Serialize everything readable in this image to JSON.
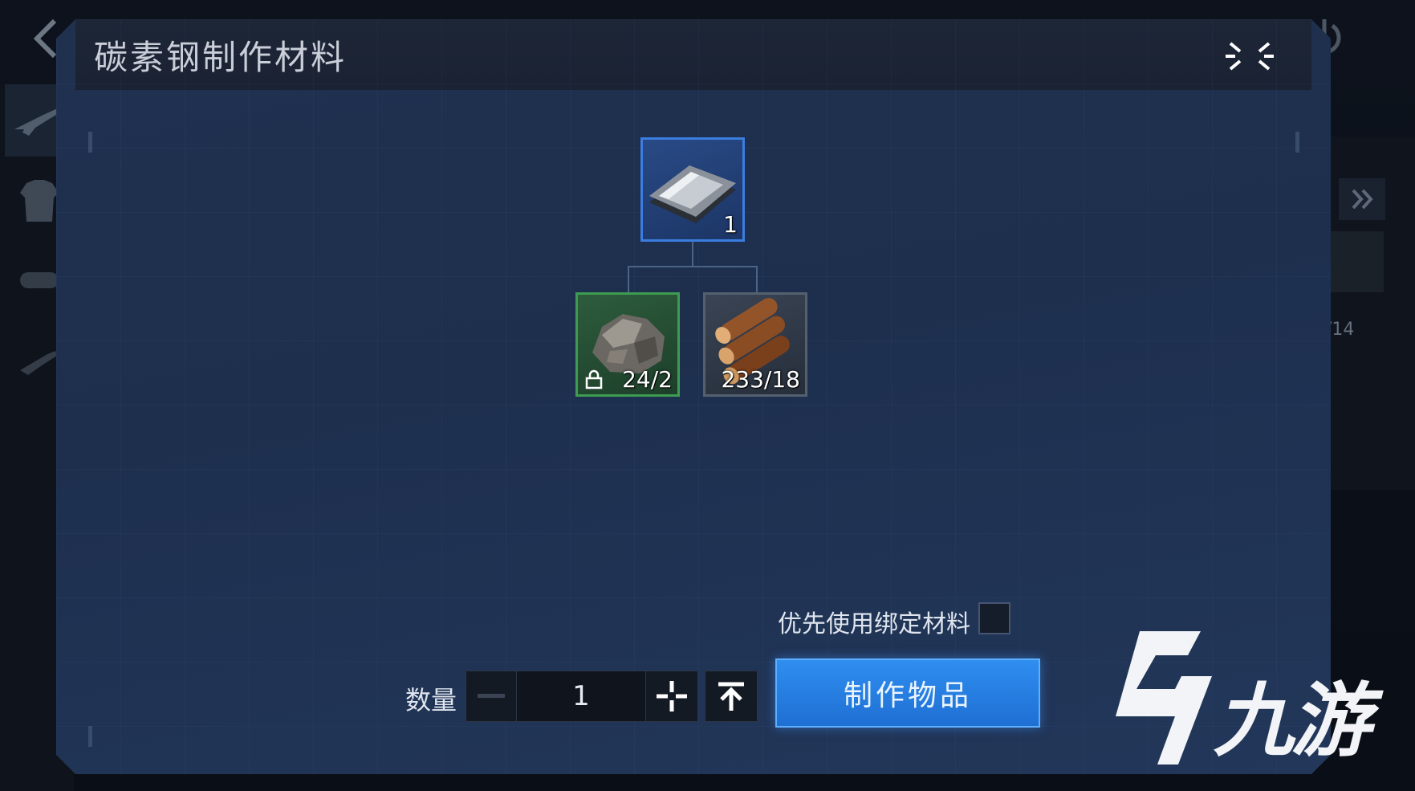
{
  "dialog": {
    "title": "碳素钢制作材料"
  },
  "product": {
    "name": "carbon-steel",
    "count": "1"
  },
  "materials": [
    {
      "name": "ore",
      "count": "24/2",
      "bound": true
    },
    {
      "name": "wood",
      "count": "233/18",
      "bound": false
    }
  ],
  "options": {
    "bind_priority_label": "优先使用绑定材料",
    "bind_priority_checked": false
  },
  "quantity": {
    "label": "数量",
    "value": "1"
  },
  "craft_button": {
    "label": "制作物品"
  },
  "background": {
    "right_panel_count": "/14"
  },
  "watermark": {
    "text": "九游"
  },
  "colors": {
    "product_border": "#3b7de0",
    "ore_border": "#3e9c52",
    "wood_border": "#55606f",
    "craft_button": "#2f8ef0"
  },
  "icons": {
    "back": "chevron-left-icon",
    "power": "power-icon",
    "close": "collapse-close-icon",
    "expand": "double-chevron-right-icon",
    "lock": "lock-icon",
    "plus": "plus-icon",
    "minus": "minus-icon",
    "max": "max-arrow-icon"
  }
}
